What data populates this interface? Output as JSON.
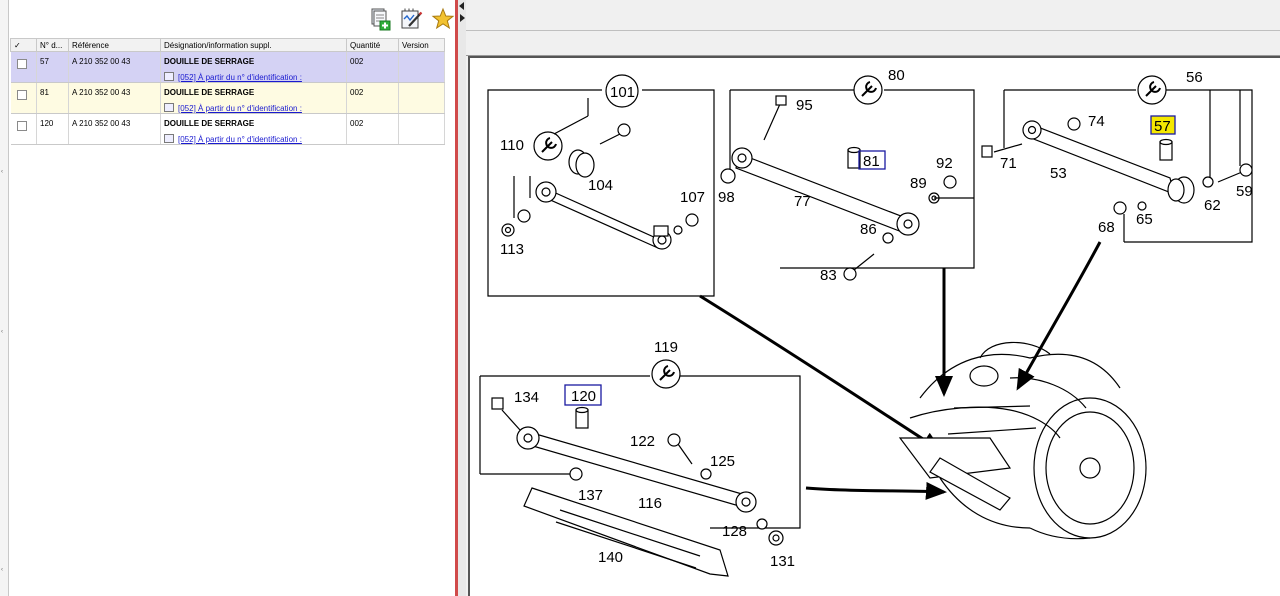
{
  "toolbar": {
    "copy_icon": "document-add-icon",
    "edit_icon": "notepad-edit-icon",
    "star_icon": "star-favorite-icon"
  },
  "table": {
    "headers": {
      "check": "✓",
      "num": "N° d...",
      "reference": "Référence",
      "designation": "Désignation/information suppl.",
      "quantity": "Quantité",
      "version": "Version"
    },
    "rows": [
      {
        "num": "57",
        "reference": "A 210 352 00 43",
        "designation": "DOUILLE DE SERRAGE",
        "note": "[052] À partir du n° d'identification :",
        "quantity": "002",
        "version": ""
      },
      {
        "num": "81",
        "reference": "A 210 352 00 43",
        "designation": "DOUILLE DE SERRAGE",
        "note": "[052] À partir du n° d'identification :",
        "quantity": "002",
        "version": ""
      },
      {
        "num": "120",
        "reference": "A 210 352 00 43",
        "designation": "DOUILLE DE SERRAGE",
        "note": "[052] À partir du n° d'identification :",
        "quantity": "002",
        "version": ""
      }
    ]
  },
  "diagram": {
    "labels": {
      "l101": "101",
      "l110": "110",
      "l104": "104",
      "l107": "107",
      "l113": "113",
      "l80": "80",
      "l95": "95",
      "l81": "81",
      "l92": "92",
      "l89": "89",
      "l98": "98",
      "l77": "77",
      "l86": "86",
      "l83": "83",
      "l56": "56",
      "l74": "74",
      "l57": "57",
      "l71": "71",
      "l53": "53",
      "l59": "59",
      "l62": "62",
      "l68": "68",
      "l65": "65",
      "l119": "119",
      "l134": "134",
      "l120": "120",
      "l122": "122",
      "l125": "125",
      "l137": "137",
      "l116": "116",
      "l128": "128",
      "l140": "140",
      "l131": "131"
    },
    "highlight_color": "#f5e800",
    "box_color": "#1a1aa0"
  }
}
